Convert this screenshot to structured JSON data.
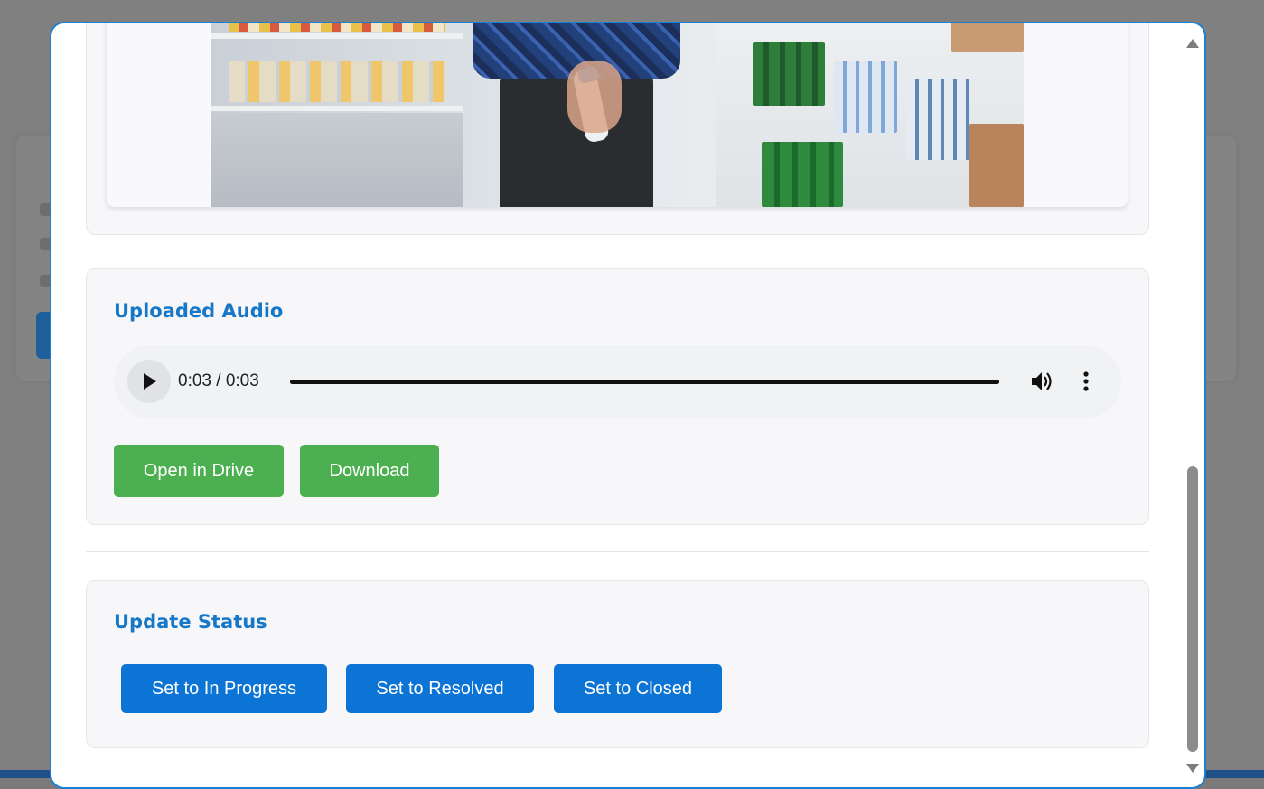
{
  "audio_section": {
    "title": "Uploaded Audio",
    "player": {
      "time_display": "0:03 / 0:03",
      "progress": 1.0,
      "play_icon": "play-icon",
      "volume_icon": "volume-icon",
      "more_icon": "more-vert-icon"
    },
    "buttons": {
      "open_in_drive": "Open in Drive",
      "download": "Download"
    }
  },
  "status_section": {
    "title": "Update Status",
    "buttons": {
      "in_progress": "Set to In Progress",
      "resolved": "Set to Resolved",
      "closed": "Set to Closed"
    }
  },
  "colors": {
    "accent_blue": "#0c74d4",
    "title_blue": "#1878c8",
    "green": "#4caf50",
    "modal_border": "#1a80d6"
  }
}
